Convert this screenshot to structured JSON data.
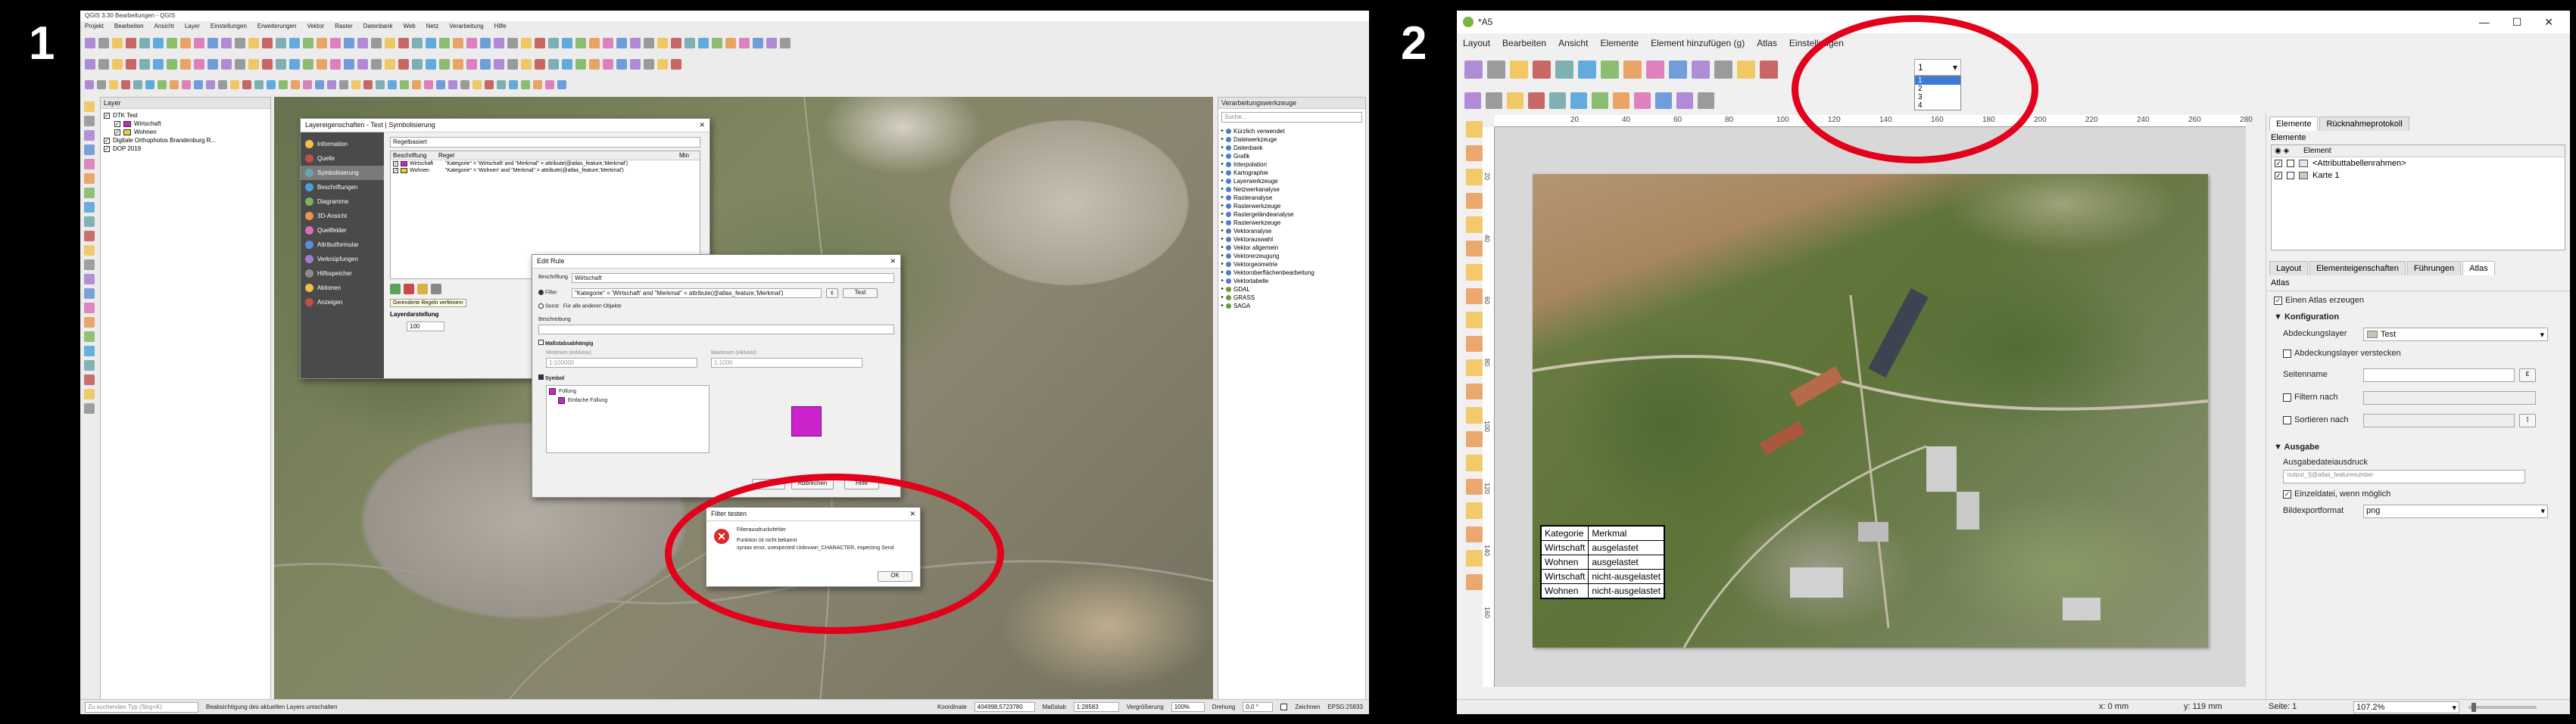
{
  "labels": {
    "left": "1",
    "right": "2"
  },
  "colors": {
    "oval": "#e3001b",
    "magenta": "#cc22cc",
    "atlas_tab_active": "#ffffff"
  },
  "left": {
    "title": "QGIS 3.30 Bearbeitungen - QGIS",
    "menu": [
      "Projekt",
      "Bearbeiten",
      "Ansicht",
      "Layer",
      "Einstellungen",
      "Erweiterungen",
      "Vektor",
      "Raster",
      "Datenbank",
      "Web",
      "Netz",
      "Verarbeitung",
      "Hilfe"
    ],
    "layers_panel": {
      "title": "Layer",
      "items": [
        {
          "label": "DTK Test",
          "level": 0
        },
        {
          "label": "Wirtschaft",
          "level": 1,
          "color": "#cc22cc"
        },
        {
          "label": "Wohnen",
          "level": 1,
          "color": "#e8d02c"
        },
        {
          "label": "Digitale Orthophotos Brandenburg R...",
          "level": 0
        },
        {
          "label": "DOP 2019",
          "level": 0
        }
      ]
    },
    "layer_props": {
      "title": "Layereigenschaften - Test | Symbolisierung",
      "nav": [
        "Information",
        "Quelle",
        "Symbolisierung",
        "Beschriftungen",
        "Diagramme",
        "3D-Ansicht",
        "Quellfelder",
        "Attributformular",
        "Verknüpfungen",
        "Hilfsspeicher",
        "Aktionen",
        "Anzeigen"
      ],
      "renderer": "Regelbasiert",
      "col_label": "Beschriftung",
      "col_rule": "Regel",
      "col_min": "Min",
      "rules": [
        {
          "label": "Wirtschaft",
          "rule": "\"Kategorie\" = 'Wirtschaft' and \"Merkmal\" = attribute(@atlas_feature,'Merkmal')"
        },
        {
          "label": "Wohnen",
          "rule": "\"Kategorie\" = 'Wohnen' and \"Merkmal\" = attribute(@atlas_feature,'Merkmal')"
        }
      ],
      "layer_rendering": "Layerdarstellung",
      "tooltip_rule": "Gerenderte Regeln verfeinern",
      "opacity_value": "100"
    },
    "edit_rule": {
      "title": "Edit Rule",
      "label_caption": "Beschriftung",
      "label_value": "Wirtschaft",
      "filter_caption": "Filter",
      "filter_value": "\"Kategorie\" = 'Wirtschaft' and \"Merkmal\" = attribute(@atlas_feature,'Merkmal')",
      "test_button": "Test",
      "else_caption": "Sonst",
      "else_text": "Für alle anderen Objekte",
      "desc_caption": "Beschreibung",
      "scale_caption": "Maßstabsabhängig",
      "min_caption": "Minimum (exklusiv)",
      "max_caption": "Maximum (inklusiv)",
      "min_value": "1:100000",
      "max_value": "1:1000",
      "symbol_caption": "Symbol",
      "symbol_tree": [
        "Füllung",
        "Einfache Füllung"
      ],
      "buttons": [
        "OK",
        "Abbrechen",
        "Hilfe"
      ]
    },
    "filter_error": {
      "title": "Filter testen",
      "heading": "Filterausdrucksfehler",
      "line1": "Funktion ist nicht bekannt",
      "line2": "syntax error, unexpected Unknown_CHARACTER, expecting Send",
      "ok": "OK"
    },
    "toolbox": {
      "title": "Verarbeitungswerkzeuge",
      "search_placeholder": "Suche...",
      "items": [
        "Kürzlich verwendet",
        "Dateiwerkzeuge",
        "Datenbank",
        "Grafik",
        "Interpolation",
        "Kartographie",
        "Layerwerkzeuge",
        "Netzwerkanalyse",
        "Rasteranalyse",
        "Rasterwerkzeuge",
        "Rastergeländeanalyse",
        "Rasterwerkzeuge",
        "Vektoranalyse",
        "Vektorauswahl",
        "Vektor allgemein",
        "Vektorerzeugung",
        "Vektorgeometrie",
        "Vektoroberflächenbearbeitung",
        "Vektortabelle",
        "GDAL",
        "GRASS",
        "SAGA"
      ]
    },
    "status": {
      "search_placeholder": "Zu suchenden Typ (Strg+K)",
      "message": "Beabsichtigung des aktuellen Layers umschalten",
      "coord_label": "Koordinate",
      "coord_value": "404998,5723780",
      "scale_label": "Maßstab",
      "scale_value": "1:28583",
      "magnifier_label": "Vergrößerung",
      "magnifier_value": "100%",
      "rotation_label": "Drehung",
      "rotation_value": "0,0 °",
      "render_label": "Zeichnen",
      "crs": "EPSG:25833"
    }
  },
  "right": {
    "title": "*A5",
    "menu": [
      "Layout",
      "Bearbeiten",
      "Ansicht",
      "Elemente",
      "Element hinzufügen (g)",
      "Atlas",
      "Einstellungen"
    ],
    "atlas_page": {
      "selected": "1",
      "options": [
        "1",
        "2",
        "3",
        "4"
      ]
    },
    "ruler_ticks": [
      "20",
      "40",
      "60",
      "80",
      "100",
      "120",
      "140",
      "160",
      "180",
      "200",
      "220",
      "240",
      "260",
      "280"
    ],
    "vruler_ticks": [
      "20",
      "40",
      "60",
      "80",
      "100",
      "120",
      "140",
      "160"
    ],
    "map_table": {
      "headers": [
        "Kategorie",
        "Merkmal"
      ],
      "rows": [
        [
          "Wirtschaft",
          "ausgelastet"
        ],
        [
          "Wohnen",
          "ausgelastet"
        ],
        [
          "Wirtschaft",
          "nicht-ausgelastet"
        ],
        [
          "Wohnen",
          "nicht-ausgelastet"
        ]
      ]
    },
    "side": {
      "tabs_top": [
        "Elemente",
        "Rücknahmeprotokoll"
      ],
      "elements_title": "Elemente",
      "elements_header": "Element",
      "elements": [
        "<Attributtabellenrahmen>",
        "Karte 1"
      ],
      "tabs_bottom": [
        "Layout",
        "Elementeigenschaften",
        "Führungen",
        "Atlas"
      ],
      "atlas_title": "Atlas",
      "generate_atlas": "Einen Atlas erzeugen",
      "config_heading": "Konfiguration",
      "coverage_label": "Abdeckungslayer",
      "coverage_value": "Test",
      "hide_coverage": "Abdeckungslayer verstecken",
      "page_name_label": "Seitenname",
      "filter_by": "Filtern nach",
      "sort_by": "Sortieren nach",
      "output_heading": "Ausgabe",
      "output_expr_label": "Ausgabedateiausdruck",
      "output_expr_value": "'output_'||@atlas_featurenumber",
      "single_file": "Einzeldatei, wenn möglich",
      "image_format_label": "Bildexportformat",
      "image_format_value": "png"
    },
    "status": {
      "x": "x: 0 mm",
      "y": "y: 119 mm",
      "page": "Seite: 1",
      "zoom": "107.2%"
    }
  }
}
